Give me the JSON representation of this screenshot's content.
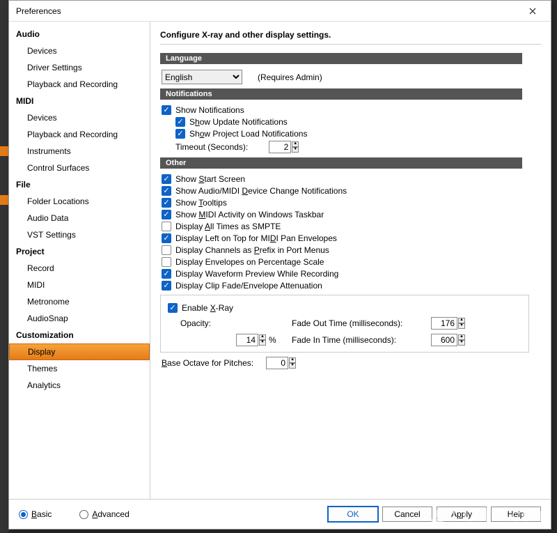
{
  "window": {
    "title": "Preferences"
  },
  "sidebar": {
    "categories": [
      {
        "label": "Audio",
        "items": [
          "Devices",
          "Driver Settings",
          "Playback and Recording"
        ]
      },
      {
        "label": "MIDI",
        "items": [
          "Devices",
          "Playback and Recording",
          "Instruments",
          "Control Surfaces"
        ]
      },
      {
        "label": "File",
        "items": [
          "Folder Locations",
          "Audio Data",
          "VST Settings"
        ]
      },
      {
        "label": "Project",
        "items": [
          "Record",
          "MIDI",
          "Metronome",
          "AudioSnap"
        ]
      },
      {
        "label": "Customization",
        "items": [
          "Display",
          "Themes",
          "Analytics"
        ],
        "selected": "Display"
      }
    ]
  },
  "content": {
    "heading": "Configure X-ray and other display settings.",
    "language": {
      "section": "Language",
      "value": "English",
      "note": "(Requires Admin)"
    },
    "notifications": {
      "section": "Notifications",
      "show": {
        "label": "Show Notifications",
        "checked": true
      },
      "update": {
        "label_pre": "S",
        "label_u": "h",
        "label_post": "ow Update Notifications",
        "checked": true
      },
      "project": {
        "label_pre": "Sh",
        "label_u": "o",
        "label_post": "w Project Load Notifications",
        "checked": true
      },
      "timeout": {
        "label": "Timeout (Seconds):",
        "value": "2"
      }
    },
    "other": {
      "section": "Other",
      "start_screen": {
        "label_pre": "Show ",
        "label_u": "S",
        "label_post": "tart Screen",
        "checked": true
      },
      "device_change": {
        "label_pre": "Show Audio/MIDI ",
        "label_u": "D",
        "label_post": "evice Change Notifications",
        "checked": true
      },
      "tooltips": {
        "label_pre": "Show ",
        "label_u": "T",
        "label_post": "ooltips",
        "checked": true
      },
      "midi_activity": {
        "label_pre": "Show ",
        "label_u": "M",
        "label_post": "IDI Activity on Windows Taskbar",
        "checked": true
      },
      "smpte": {
        "label_pre": "Display ",
        "label_u": "A",
        "label_post": "ll Times as SMPTE",
        "checked": false
      },
      "pan_env": {
        "label_pre": "Display Left on Top for MI",
        "label_u": "D",
        "label_post": "I Pan Envelopes",
        "checked": true
      },
      "prefix": {
        "label_pre": "Display Channels as ",
        "label_u": "P",
        "label_post": "refix in Port Menus",
        "checked": false
      },
      "percent": {
        "label": "Display Envelopes on Percentage Scale",
        "checked": false
      },
      "waveform": {
        "label": "Display Waveform Preview While Recording",
        "checked": true
      },
      "clipfade": {
        "label": "Display Clip Fade/Envelope Attenuation",
        "checked": true
      }
    },
    "xray": {
      "enable": {
        "label_pre": "Enable ",
        "label_u": "X",
        "label_post": "-Ray",
        "checked": true
      },
      "opacity": {
        "label": "Opacity:",
        "value": "14",
        "pct": "%"
      },
      "fadeout": {
        "label": "Fade Out Time (milliseconds):",
        "value": "176"
      },
      "fadein": {
        "label": "Fade In Time (milliseconds):",
        "value": "600"
      }
    },
    "base_octave": {
      "label_pre": "",
      "label_u": "B",
      "label_post": "ase Octave for Pitches:",
      "value": "0"
    }
  },
  "footer": {
    "basic": {
      "label_u": "B",
      "label_post": "asic"
    },
    "advanced": {
      "label_u": "A",
      "label_post": "dvanced"
    },
    "ok": "OK",
    "cancel": "Cancel",
    "apply": {
      "pre": "A",
      "u": "p",
      "post": "ply"
    },
    "help": "Help"
  },
  "watermark": "LO4D.com"
}
